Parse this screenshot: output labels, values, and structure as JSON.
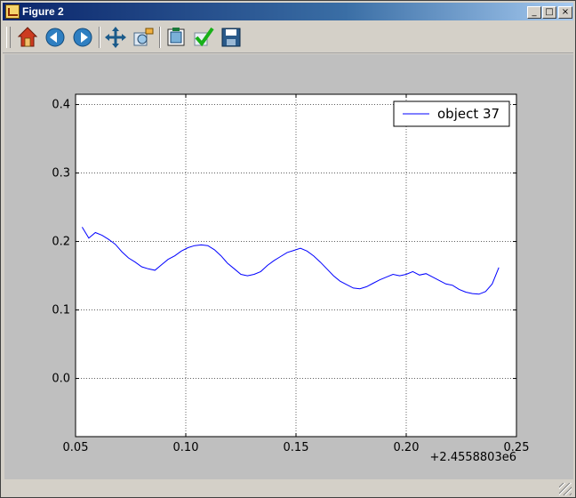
{
  "window": {
    "title": "Figure 2",
    "buttons": [
      "_",
      "□",
      "×"
    ]
  },
  "toolbar": {
    "items": [
      {
        "name": "home-icon",
        "tooltip": "Home"
      },
      {
        "name": "back-icon",
        "tooltip": "Back"
      },
      {
        "name": "forward-icon",
        "tooltip": "Forward"
      },
      {
        "name": "pan-icon",
        "tooltip": "Pan"
      },
      {
        "name": "zoom-icon",
        "tooltip": "Zoom"
      },
      {
        "name": "subplots-icon",
        "tooltip": "Configure subplots"
      },
      {
        "name": "edit-icon",
        "tooltip": "Edit"
      },
      {
        "name": "save-icon",
        "tooltip": "Save"
      }
    ]
  },
  "colors": {
    "line": "#0000ff",
    "axes_bg": "#ffffff",
    "figure_bg": "#bfbfbf"
  },
  "chart_data": {
    "type": "line",
    "title": "",
    "xlabel": "",
    "ylabel": "",
    "x_offset_label": "+2.4558803e6",
    "xlim": [
      0.05,
      0.25
    ],
    "ylim": [
      -0.085,
      0.415
    ],
    "xticks": [
      0.05,
      0.1,
      0.15,
      0.2,
      0.25
    ],
    "xtick_labels": [
      "0.05",
      "0.10",
      "0.15",
      "0.20",
      "0.25"
    ],
    "yticks": [
      0.0,
      0.1,
      0.2,
      0.3,
      0.4
    ],
    "ytick_labels": [
      "0.0",
      "0.1",
      "0.2",
      "0.3",
      "0.4"
    ],
    "grid": true,
    "legend_position": "top-right",
    "series": [
      {
        "name": "object 37",
        "x": [
          0.053,
          0.056,
          0.059,
          0.062,
          0.065,
          0.068,
          0.071,
          0.074,
          0.077,
          0.08,
          0.083,
          0.086,
          0.089,
          0.092,
          0.095,
          0.098,
          0.101,
          0.104,
          0.107,
          0.11,
          0.113,
          0.116,
          0.119,
          0.122,
          0.125,
          0.128,
          0.131,
          0.134,
          0.137,
          0.14,
          0.143,
          0.146,
          0.149,
          0.152,
          0.155,
          0.158,
          0.161,
          0.164,
          0.167,
          0.17,
          0.173,
          0.176,
          0.179,
          0.182,
          0.185,
          0.188,
          0.191,
          0.194,
          0.197,
          0.2,
          0.203,
          0.206,
          0.209,
          0.212,
          0.215,
          0.218,
          0.221,
          0.224,
          0.227,
          0.23,
          0.233,
          0.236,
          0.239,
          0.242
        ],
        "y": [
          0.221,
          0.205,
          0.213,
          0.209,
          0.203,
          0.196,
          0.185,
          0.176,
          0.17,
          0.163,
          0.16,
          0.158,
          0.166,
          0.174,
          0.179,
          0.186,
          0.191,
          0.194,
          0.195,
          0.194,
          0.188,
          0.179,
          0.168,
          0.16,
          0.152,
          0.15,
          0.152,
          0.156,
          0.165,
          0.172,
          0.178,
          0.184,
          0.187,
          0.19,
          0.186,
          0.179,
          0.17,
          0.16,
          0.15,
          0.142,
          0.137,
          0.132,
          0.131,
          0.134,
          0.139,
          0.144,
          0.148,
          0.152,
          0.15,
          0.152,
          0.156,
          0.151,
          0.153,
          0.148,
          0.143,
          0.138,
          0.136,
          0.13,
          0.126,
          0.124,
          0.123,
          0.127,
          0.138,
          0.162
        ]
      }
    ]
  }
}
